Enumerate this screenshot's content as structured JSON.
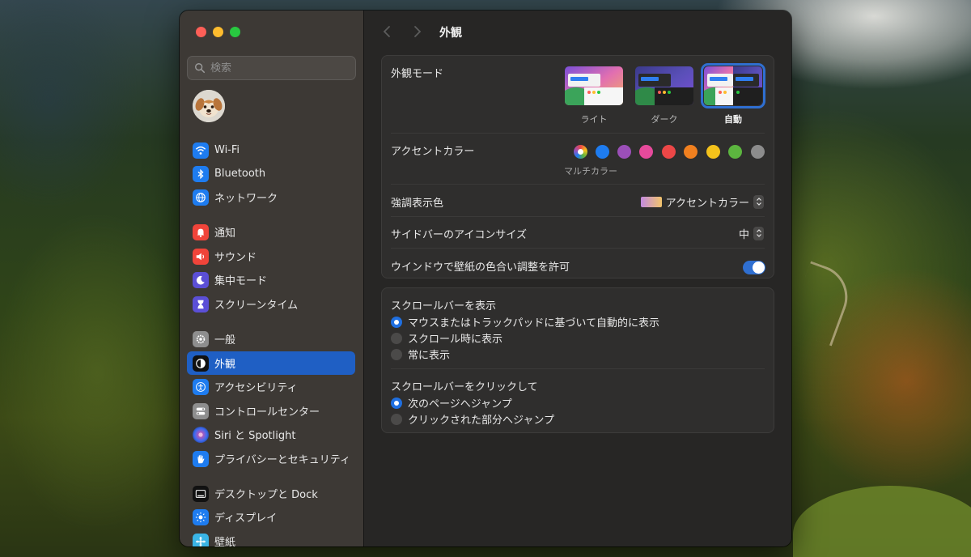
{
  "window": {
    "page_title": "外観",
    "search": {
      "placeholder": "検索"
    }
  },
  "sidebar": {
    "groups": [
      [
        {
          "label": "Wi-Fi",
          "icon": "wifi-icon",
          "color": "#1e7cf0"
        },
        {
          "label": "Bluetooth",
          "icon": "bluetooth-icon",
          "color": "#1e7cf0"
        },
        {
          "label": "ネットワーク",
          "icon": "globe-icon",
          "color": "#1e7cf0"
        }
      ],
      [
        {
          "label": "通知",
          "icon": "bell-icon",
          "color": "#f0443a"
        },
        {
          "label": "サウンド",
          "icon": "speaker-icon",
          "color": "#f0443a"
        },
        {
          "label": "集中モード",
          "icon": "moon-icon",
          "color": "#5b4fd6"
        },
        {
          "label": "スクリーンタイム",
          "icon": "hourglass-icon",
          "color": "#5b4fd6"
        }
      ],
      [
        {
          "label": "一般",
          "icon": "gear-icon",
          "color": "#8e8e8e"
        },
        {
          "label": "外観",
          "icon": "appearance-icon",
          "color": "#111111",
          "active": true
        },
        {
          "label": "アクセシビリティ",
          "icon": "accessibility-icon",
          "color": "#1e7cf0"
        },
        {
          "label": "コントロールセンター",
          "icon": "control-center-icon",
          "color": "#8e8e8e"
        },
        {
          "label": "Siri と Spotlight",
          "icon": "siri-icon",
          "color": "#6a3fd0"
        },
        {
          "label": "プライバシーとセキュリティ",
          "icon": "hand-icon",
          "color": "#1e7cf0"
        }
      ],
      [
        {
          "label": "デスクトップと Dock",
          "icon": "dock-icon",
          "color": "#111111"
        },
        {
          "label": "ディスプレイ",
          "icon": "sun-icon",
          "color": "#1e7cf0"
        },
        {
          "label": "壁紙",
          "icon": "wallpaper-icon",
          "color": "#3ab5e6"
        }
      ]
    ]
  },
  "appearance": {
    "mode_label": "外観モード",
    "modes": [
      {
        "label": "ライト",
        "selected": false
      },
      {
        "label": "ダーク",
        "selected": false
      },
      {
        "label": "自動",
        "selected": true
      }
    ],
    "accent_label": "アクセントカラー",
    "accent_colors": [
      {
        "name": "multicolor",
        "color": "multicolor",
        "selected": true
      },
      {
        "name": "blue",
        "color": "#1e7cf0"
      },
      {
        "name": "purple",
        "color": "#9b4fb8"
      },
      {
        "name": "pink",
        "color": "#e64a9b"
      },
      {
        "name": "red",
        "color": "#ec4747"
      },
      {
        "name": "orange",
        "color": "#f1801f"
      },
      {
        "name": "yellow",
        "color": "#f4c21b"
      },
      {
        "name": "green",
        "color": "#5cb53f"
      },
      {
        "name": "graphite",
        "color": "#8c8c8c"
      }
    ],
    "accent_selected_label": "マルチカラー",
    "highlight_label": "強調表示色",
    "highlight_value": "アクセントカラー",
    "icon_size_label": "サイドバーのアイコンサイズ",
    "icon_size_value": "中",
    "tinting_label": "ウインドウで壁紙の色合い調整を許可",
    "tinting_enabled": true
  },
  "scrollbars": {
    "show_title": "スクロールバーを表示",
    "show_options": [
      {
        "label": "マウスまたはトラックパッドに基づいて自動的に表示",
        "selected": true
      },
      {
        "label": "スクロール時に表示",
        "selected": false
      },
      {
        "label": "常に表示",
        "selected": false
      }
    ],
    "click_title": "スクロールバーをクリックして",
    "click_options": [
      {
        "label": "次のページへジャンプ",
        "selected": true
      },
      {
        "label": "クリックされた部分へジャンプ",
        "selected": false
      }
    ]
  },
  "help": {
    "label": "?"
  }
}
